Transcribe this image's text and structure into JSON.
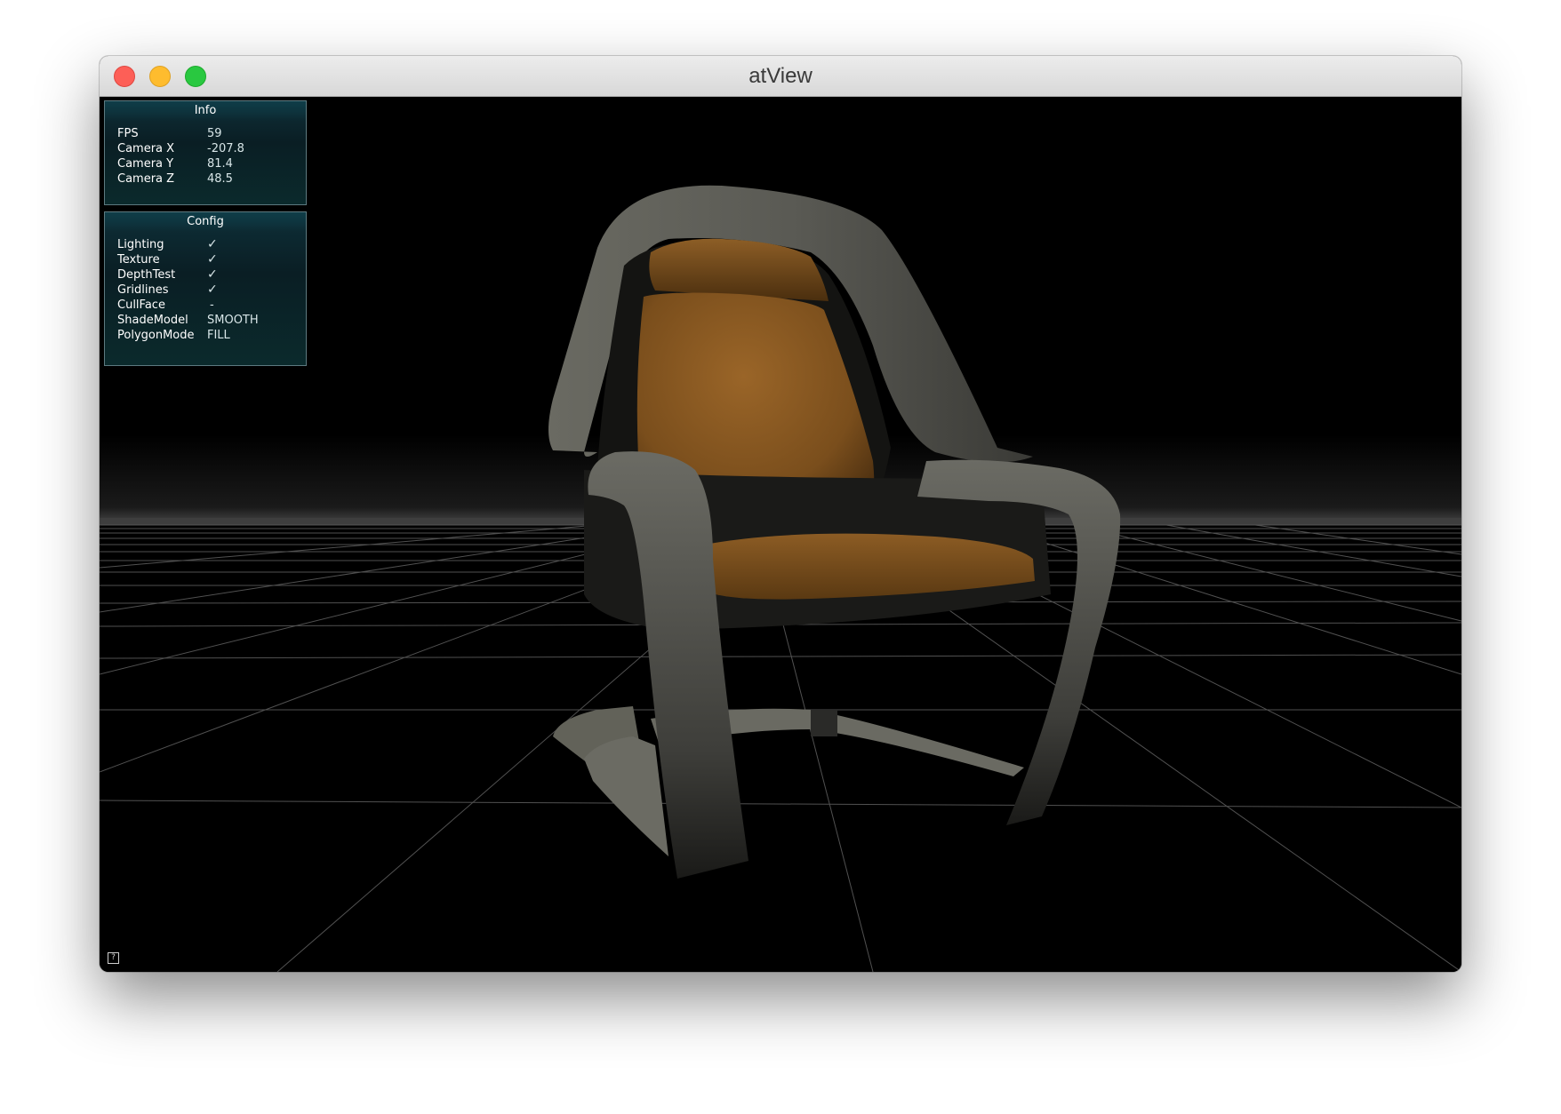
{
  "window": {
    "title": "atView"
  },
  "info_panel": {
    "title": "Info",
    "rows": [
      {
        "label": "FPS",
        "value": "59"
      },
      {
        "label": "Camera X",
        "value": "-207.8"
      },
      {
        "label": "Camera Y",
        "value": "81.4"
      },
      {
        "label": "Camera Z",
        "value": "48.5"
      }
    ]
  },
  "config_panel": {
    "title": "Config",
    "rows": [
      {
        "label": "Lighting",
        "value": "✓"
      },
      {
        "label": "Texture",
        "value": "✓"
      },
      {
        "label": "DepthTest",
        "value": "✓"
      },
      {
        "label": "Gridlines",
        "value": "✓"
      },
      {
        "label": "CullFace",
        "value": "-"
      },
      {
        "label": "ShadeModel",
        "value": "SMOOTH"
      },
      {
        "label": "PolygonMode",
        "value": "FILL"
      }
    ]
  },
  "help_button": {
    "label": "?"
  },
  "colors": {
    "grid": "#5a5a5a",
    "chair_frame": "#5b5b55",
    "cushion": "#8a5a22",
    "panel_bg": "#0b2a30",
    "check": "#d9f5a0"
  }
}
